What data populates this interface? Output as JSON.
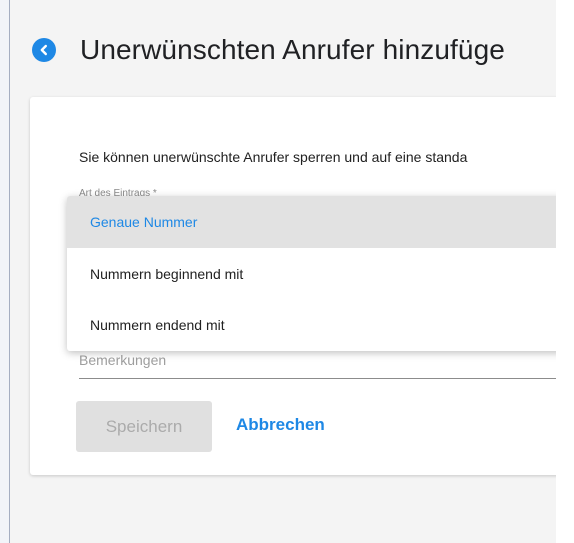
{
  "header": {
    "title": "Unerwünschten Anrufer hinzufüge",
    "back_icon": "chevron-left-icon"
  },
  "form": {
    "intro": "Sie können unerwünschte Anrufer sperren und auf eine standa",
    "entry_type_label": "Art des Eintrags *",
    "remark_placeholder": "Bemerkungen"
  },
  "dropdown": {
    "selected_index": 0,
    "options": [
      "Genaue Nummer",
      "Nummern beginnend mit",
      "Nummern endend mit"
    ]
  },
  "actions": {
    "save_label": "Speichern",
    "cancel_label": "Abbrechen"
  },
  "colors": {
    "accent": "#1e88e5",
    "page_bg": "#f4f4f4",
    "selected_bg": "#e2e2e2",
    "disabled_button": "#e0e0e0"
  }
}
